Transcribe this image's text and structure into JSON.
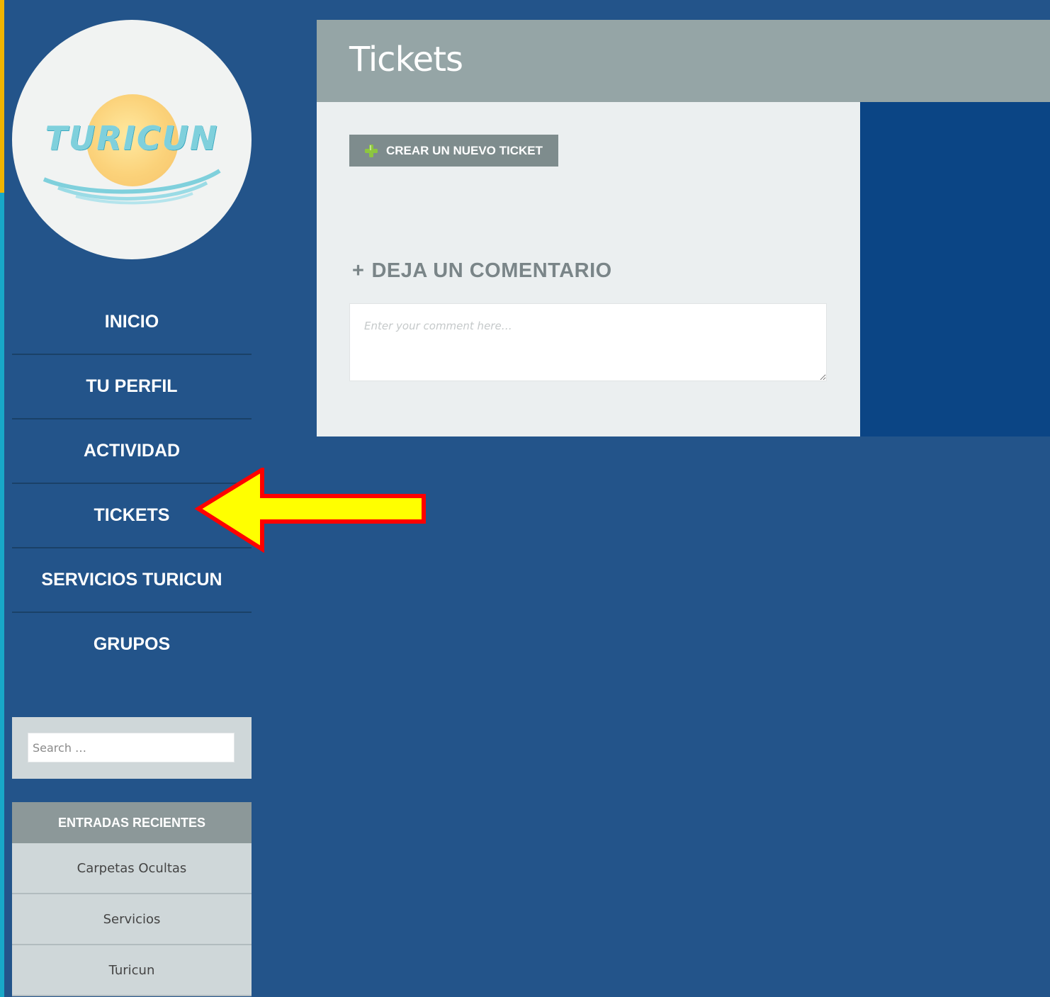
{
  "logo": {
    "text": "TURICUN"
  },
  "nav": {
    "items": [
      {
        "label": "INICIO"
      },
      {
        "label": "TU PERFIL"
      },
      {
        "label": "ACTIVIDAD"
      },
      {
        "label": "TICKETS"
      },
      {
        "label": "SERVICIOS TURICUN"
      },
      {
        "label": "GRUPOS"
      }
    ]
  },
  "search": {
    "placeholder": "Search …"
  },
  "recent": {
    "heading": "ENTRADAS RECIENTES",
    "items": [
      {
        "label": "Carpetas Ocultas"
      },
      {
        "label": "Servicios"
      },
      {
        "label": "Turicun"
      }
    ]
  },
  "page": {
    "title": "Tickets"
  },
  "tickets": {
    "new_button_label": "CREAR UN NUEVO TICKET"
  },
  "comment": {
    "heading": "DEJA UN COMENTARIO",
    "placeholder": "Enter your comment here…"
  },
  "colors": {
    "background": "#23548a",
    "title_bar": "#95a5a6",
    "content_panel": "#ebeff0",
    "right_panel": "#0b4585",
    "button": "#7e8c8d",
    "arrow_fill": "#ffff00",
    "arrow_outline": "#ff0000",
    "plus_icon": "#8dc63f"
  },
  "icons": {
    "new_ticket": "plus-circle-icon",
    "comment": "plus-icon",
    "annotation": "arrow-left-icon"
  }
}
